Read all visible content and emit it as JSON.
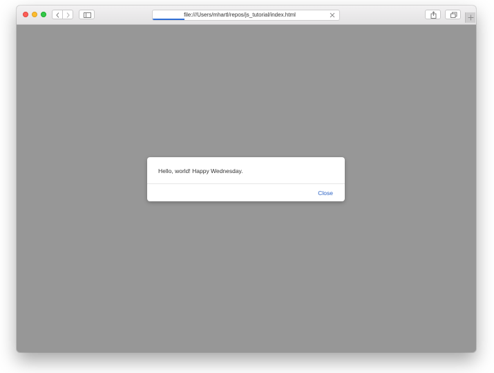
{
  "browser": {
    "address_bar": {
      "url": "file:///Users/mhartl/repos/js_tutorial/index.html",
      "load_progress_fraction": 0.17
    },
    "icons": {
      "back": "chevron-left-icon",
      "forward": "chevron-right-icon",
      "sidebar": "sidebar-icon",
      "stop": "close-icon",
      "share": "share-icon",
      "tabs": "tabs-icon",
      "new_tab": "plus-icon"
    },
    "colors": {
      "close_light": "#fc5e57",
      "minimize_light": "#fdbc2e",
      "zoom_light": "#33c749",
      "page_overlay": "#979797",
      "progress": "#2f6ed6"
    }
  },
  "alert": {
    "message": "Hello, world! Happy Wednesday.",
    "close_label": "Close",
    "link_color": "#2b62c4"
  }
}
